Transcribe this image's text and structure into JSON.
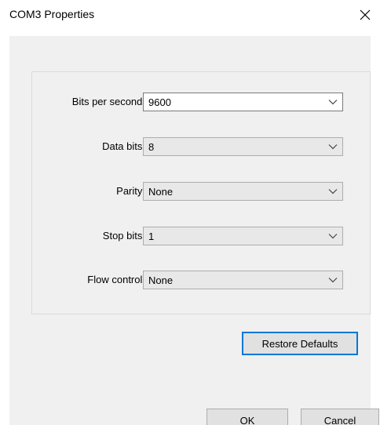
{
  "window": {
    "title": "COM3 Properties",
    "close_glyph": "✕"
  },
  "settings": [
    {
      "label": "Bits per second:",
      "value": "9600",
      "style": "editable"
    },
    {
      "label": "Data bits:",
      "value": "8",
      "style": "dropdown"
    },
    {
      "label": "Parity:",
      "value": "None",
      "style": "dropdown"
    },
    {
      "label": "Stop bits:",
      "value": "1",
      "style": "dropdown"
    },
    {
      "label": "Flow control:",
      "value": "None",
      "style": "dropdown"
    }
  ],
  "buttons": {
    "restore_defaults": "Restore Defaults",
    "ok": "OK",
    "cancel": "Cancel"
  },
  "colors": {
    "client_bg": "#f0f0f0",
    "button_bg": "#e1e1e1",
    "focus_border": "#0078d7"
  },
  "icons": {
    "close": "close-icon",
    "dropdown": "chevron-down-icon"
  }
}
